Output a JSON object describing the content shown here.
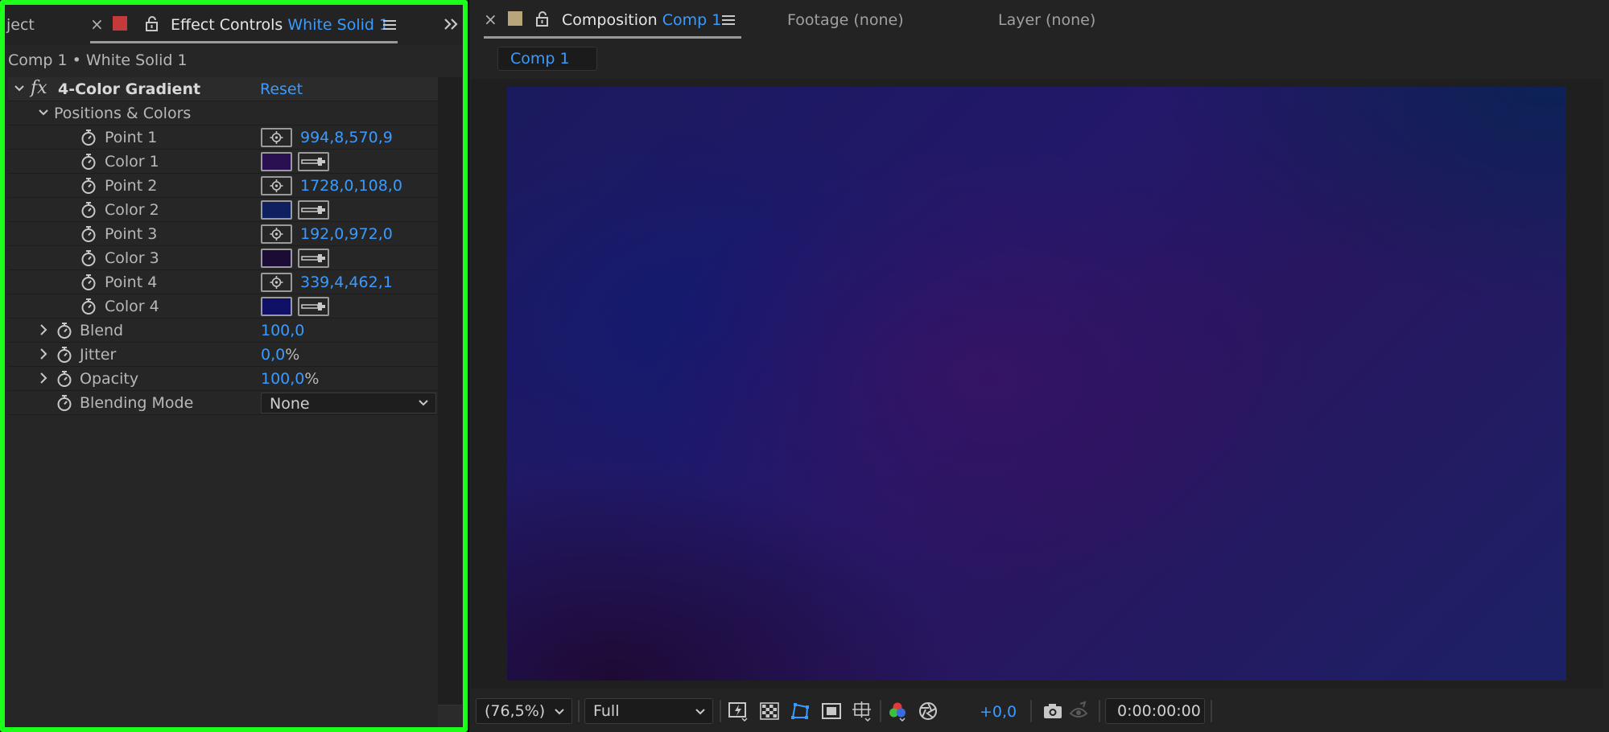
{
  "left_panel": {
    "tabs": {
      "project_partial": "ject",
      "effect_controls_label": "Effect Controls",
      "effect_controls_layer": "White Solid 1",
      "tab_color": "#c23a3a"
    },
    "breadcrumb": "Comp 1 • White Solid 1",
    "effect": {
      "fx_label": "fx",
      "name": "4-Color Gradient",
      "reset": "Reset",
      "group": "Positions & Colors",
      "points": [
        {
          "label": "Point 1",
          "value": "994,8,570,9"
        },
        {
          "label": "Point 2",
          "value": "1728,0,108,0"
        },
        {
          "label": "Point 3",
          "value": "192,0,972,0"
        },
        {
          "label": "Point 4",
          "value": "339,4,462,1"
        }
      ],
      "colors": [
        {
          "label": "Color 1",
          "hex": "#2a1050"
        },
        {
          "label": "Color 2",
          "hex": "#0e2060"
        },
        {
          "label": "Color 3",
          "hex": "#1c0c35"
        },
        {
          "label": "Color 4",
          "hex": "#101066"
        }
      ],
      "blend": {
        "label": "Blend",
        "value": "100,0"
      },
      "jitter": {
        "label": "Jitter",
        "value": "0,0",
        "unit": "%"
      },
      "opacity": {
        "label": "Opacity",
        "value": "100,0",
        "unit": "%"
      },
      "blending_mode": {
        "label": "Blending Mode",
        "value": "None"
      }
    }
  },
  "right_panel": {
    "tabs": {
      "composition_label": "Composition",
      "composition_name": "Comp 1",
      "footage": "Footage (none)",
      "layer": "Layer (none)",
      "tab_color": "#b8a57a"
    },
    "subtab": "Comp 1",
    "toolbar": {
      "zoom": "(76,5%)",
      "resolution": "Full",
      "exposure": "+0,0",
      "timecode": "0:00:00:00"
    }
  }
}
